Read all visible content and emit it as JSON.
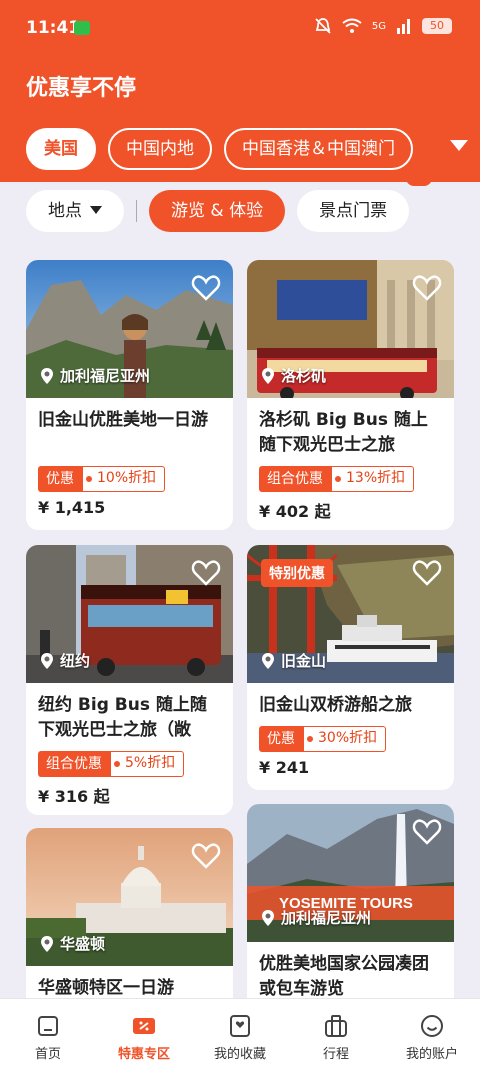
{
  "status_bar": {
    "time": "11:41",
    "network": "5G",
    "battery": "50"
  },
  "page": {
    "title": "优惠享不停"
  },
  "regions": [
    {
      "label": "美国"
    },
    {
      "label": "中国内地"
    },
    {
      "label": "中国香港＆中国澳门"
    }
  ],
  "filters": {
    "location": "地点",
    "tour": "游览 & 体验",
    "tickets": "景点门票"
  },
  "cards": [
    {
      "location": "加利福尼亚州",
      "title": "旧金山优胜美地一日游",
      "badge_type": "优惠",
      "badge_discount": "10%折扣",
      "price": "¥ 1,415"
    },
    {
      "location": "洛杉矶",
      "title": "洛杉矶 Big Bus 随上随下观光巴士之旅（敞...",
      "badge_type": "组合优惠",
      "badge_discount": "13%折扣",
      "price": "¥ 402 起"
    },
    {
      "location": "纽约",
      "title": "纽约 Big Bus 随上随下观光巴士之旅（敞篷...",
      "badge_type": "组合优惠",
      "badge_discount": "5%折扣",
      "price": "¥ 316 起"
    },
    {
      "location": "旧金山",
      "tag": "特别优惠",
      "title": "旧金山双桥游船之旅",
      "badge_type": "优惠",
      "badge_discount": "30%折扣",
      "price": "¥ 241"
    },
    {
      "location": "华盛顿",
      "title": "华盛顿特区一日游"
    },
    {
      "location": "加利福尼亚州",
      "image_text": "YOSEMITE TOURS",
      "title": "优胜美地国家公园凑团或包车游览"
    }
  ],
  "tabs": [
    {
      "label": "首页"
    },
    {
      "label": "特惠专区"
    },
    {
      "label": "我的收藏"
    },
    {
      "label": "行程"
    },
    {
      "label": "我的账户"
    }
  ],
  "colors": {
    "brand": "#F0532A",
    "background": "#EEECF4"
  }
}
